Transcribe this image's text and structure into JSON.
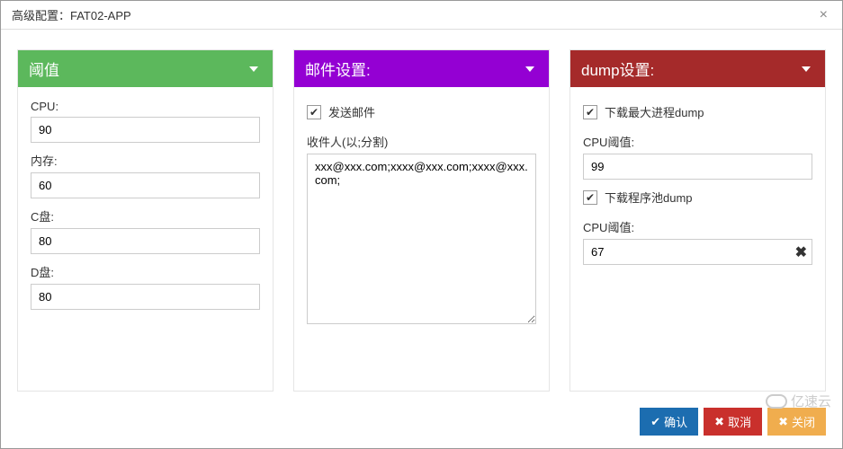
{
  "modal": {
    "title": "高级配置：FAT02-APP"
  },
  "panels": {
    "threshold": {
      "title": "阈值",
      "fields": {
        "cpu": {
          "label": "CPU:",
          "value": "90"
        },
        "memory": {
          "label": "内存:",
          "value": "60"
        },
        "c_drive": {
          "label": "C盘:",
          "value": "80"
        },
        "d_drive": {
          "label": "D盘:",
          "value": "80"
        }
      }
    },
    "email": {
      "title": "邮件设置:",
      "send_email": {
        "label": "发送邮件",
        "checked": true
      },
      "recipients": {
        "label": "收件人(以;分割)",
        "value": "xxx@xxx.com;xxxx@xxx.com;xxxx@xxx.com;"
      }
    },
    "dump": {
      "title": "dump设置:",
      "download_max_process": {
        "label": "下载最大进程dump",
        "checked": true
      },
      "cpu_threshold_1": {
        "label": "CPU阈值:",
        "value": "99"
      },
      "download_app_pool": {
        "label": "下载程序池dump",
        "checked": true
      },
      "cpu_threshold_2": {
        "label": "CPU阈值:",
        "value": "67"
      }
    }
  },
  "footer": {
    "confirm": "确认",
    "cancel": "取消",
    "close": "关闭"
  },
  "watermark": "亿速云"
}
